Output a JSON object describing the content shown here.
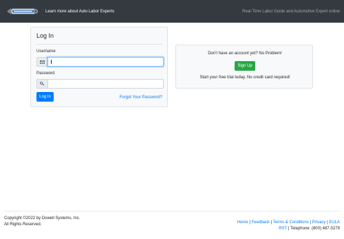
{
  "navbar": {
    "logo_text": "Auto Labor Experts",
    "link": "Learn more about Auto Labor Experts",
    "tagline": "Real-Time Labor Guide and Automotive Expert online"
  },
  "login": {
    "title": "Log In",
    "username_label": "Username",
    "username_value": "",
    "password_label": "Password",
    "password_value": "",
    "login_button": "Log In",
    "forgot_link": "Forgot Your Password?"
  },
  "signup": {
    "prompt": "Don't have an account yet? No Problem!",
    "button": "Sign Up",
    "note": "Start your free trial today. No credit card required!"
  },
  "footer": {
    "copyright_line1": "Copyright ©2022 by Dowell Systems, Inc.",
    "copyright_line2": "All Rights Reserved.",
    "links": {
      "home": "Home",
      "feedback": "Feedback",
      "terms": "Terms & Conditions",
      "privacy": "Privacy",
      "eula": "EULA",
      "rst": "RST"
    },
    "separator": "|",
    "telephone": "Telephone: (800) 487-0279"
  },
  "colors": {
    "navbar": "#343a40",
    "primary": "#007bff",
    "success": "#28a745",
    "card_bg": "#f8f9fa"
  },
  "icons": {
    "username_addon": "envelope-icon",
    "password_addon": "key-icon"
  }
}
